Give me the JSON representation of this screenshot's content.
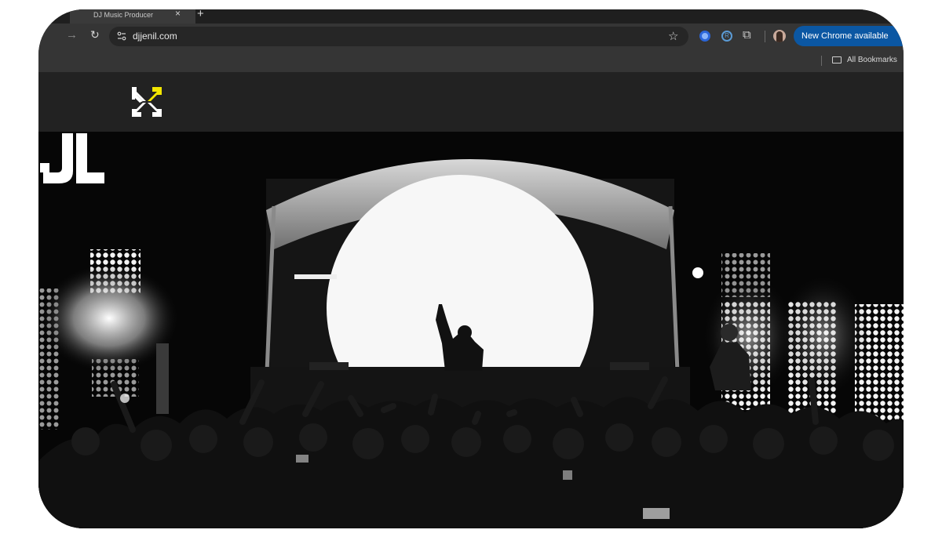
{
  "browser": {
    "tab_title": "DJ Music Producer",
    "tab_close": "×",
    "new_tab": "+",
    "forward_icon": "arrow-right-icon",
    "reload_icon": "reload-icon",
    "url": "djjenil.com",
    "update_button": "New Chrome available",
    "bookmarks_label": "All Bookmarks"
  },
  "site": {
    "logo_icon": "arrows-converge-logo",
    "brand_mark": "JL",
    "accent_color": "#f2e600"
  }
}
